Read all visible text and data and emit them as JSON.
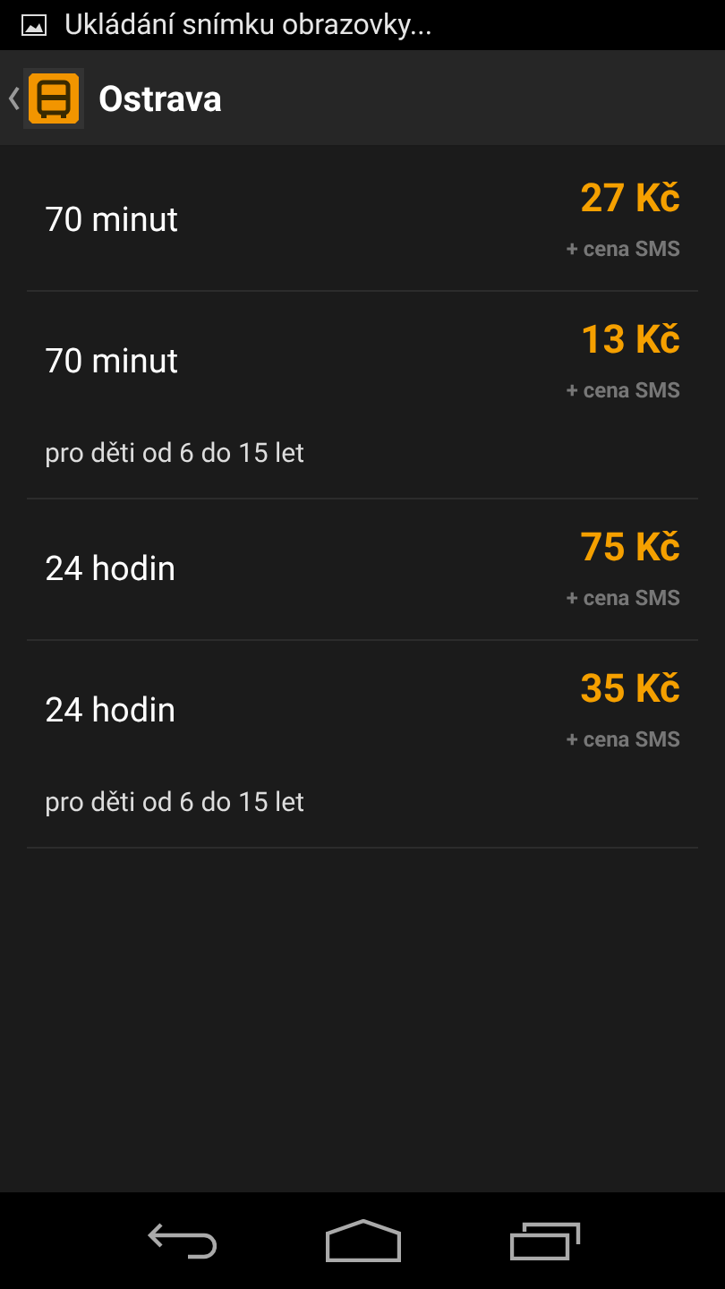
{
  "status_bar": {
    "notification": "Ukládání snímku obrazovky..."
  },
  "action_bar": {
    "title": "Ostrava"
  },
  "tickets": [
    {
      "name": "70 minut",
      "price": "27 Kč",
      "price_note": "+ cena SMS"
    },
    {
      "name": "70 minut",
      "price": "13 Kč",
      "price_note": "+ cena SMS",
      "note": "pro děti od 6 do 15 let"
    },
    {
      "name": "24 hodin",
      "price": "75 Kč",
      "price_note": "+ cena SMS"
    },
    {
      "name": "24 hodin",
      "price": "35 Kč",
      "price_note": "+ cena SMS",
      "note": "pro děti od 6 do 15 let"
    }
  ]
}
